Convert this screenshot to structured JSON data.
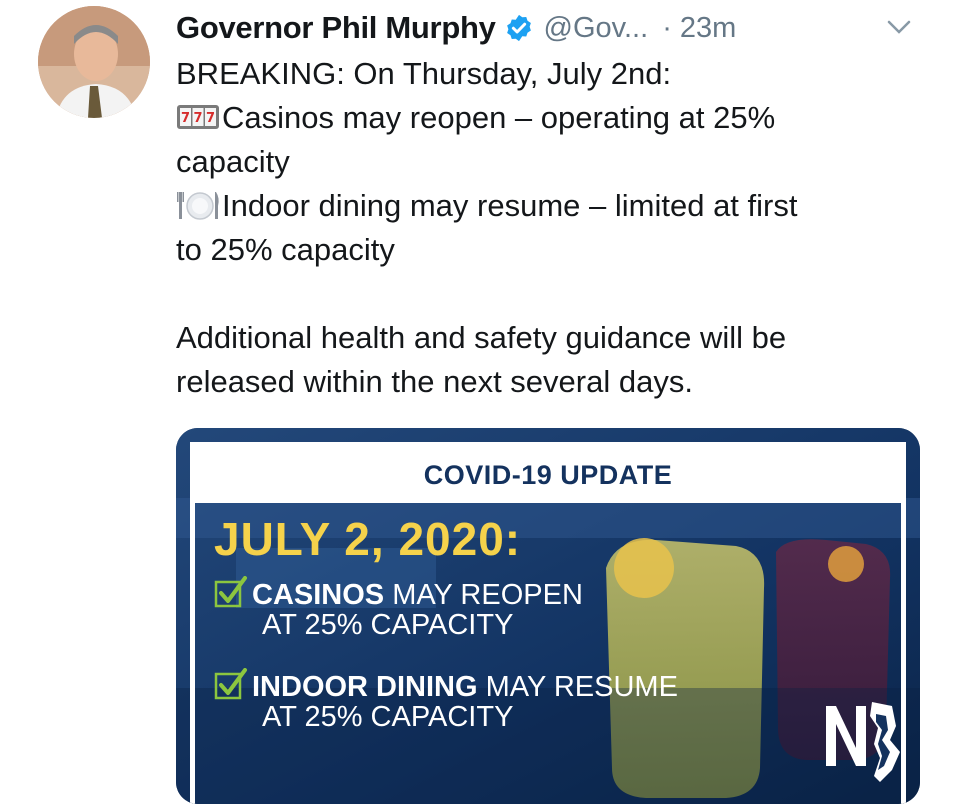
{
  "tweet": {
    "author": {
      "name": "Governor Phil Murphy",
      "handle": "@Gov...",
      "separator": "·",
      "time": "23m"
    },
    "text": {
      "line1": "BREAKING: On Thursday, July 2nd:",
      "casino_line_a": "Casinos may reopen – operating at 25%",
      "casino_line_b": "capacity",
      "dining_line_a": "Indoor dining may resume – limited at first",
      "dining_line_b": "to 25% capacity",
      "additional_line_a": "Additional health and safety guidance will be",
      "additional_line_b": "released within the next several days."
    },
    "icons": {
      "verified": "verified-badge-icon",
      "menu": "chevron-down-icon",
      "casino_emoji": "slot-machine-icon",
      "dining_emoji": "fork-knife-plate-icon"
    },
    "colors": {
      "verified": "#1da1f2",
      "meta_text": "#657786",
      "graphic_bg": "#0e2a52",
      "graphic_date": "#f5d24b",
      "graphic_check": "#8cc63f"
    }
  },
  "graphic": {
    "banner": "COVID-19 UPDATE",
    "date": "JULY 2, 2020:",
    "items": [
      {
        "bold": "CASINOS",
        "rest": " MAY REOPEN",
        "sub": "AT 25% CAPACITY"
      },
      {
        "bold": "INDOOR DINING",
        "rest": " MAY RESUME",
        "sub": "AT 25% CAPACITY"
      }
    ]
  }
}
